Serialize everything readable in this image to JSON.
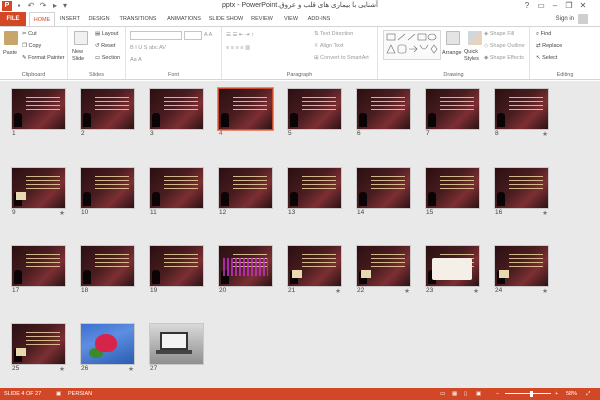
{
  "window": {
    "title": "آشنایی با بیماری های قلب و عروق.pptx - PowerPoint",
    "controls": [
      "?",
      "▭",
      "–",
      "❐",
      "✕"
    ]
  },
  "ribbon_tabs": {
    "file": "FILE",
    "tabs": [
      "HOME",
      "INSERT",
      "DESIGN",
      "TRANSITIONS",
      "ANIMATIONS",
      "SLIDE SHOW",
      "REVIEW",
      "VIEW",
      "ADD-INS"
    ],
    "active": "HOME",
    "sign_in": "Sign in"
  },
  "ribbon": {
    "clipboard": {
      "paste": "Paste",
      "cut": "Cut",
      "copy": "Copy",
      "format_painter": "Format Painter",
      "label": "Clipboard"
    },
    "slides": {
      "new_slide": "New Slide",
      "layout": "Layout",
      "reset": "Reset",
      "section": "Section",
      "label": "Slides"
    },
    "font": {
      "label": "Font"
    },
    "paragraph": {
      "text_direction": "Text Direction",
      "align_text": "Align Text",
      "convert_smartart": "Convert to SmartArt",
      "label": "Paragraph"
    },
    "drawing": {
      "arrange": "Arrange",
      "quick_styles": "Quick Styles",
      "shape_fill": "Shape Fill",
      "shape_outline": "Shape Outline",
      "shape_effects": "Shape Effects",
      "label": "Drawing"
    },
    "editing": {
      "find": "Find",
      "replace": "Replace",
      "select": "Select",
      "label": "Editing"
    }
  },
  "slides": [
    {
      "number": "1",
      "star": ""
    },
    {
      "number": "2",
      "star": ""
    },
    {
      "number": "3",
      "star": ""
    },
    {
      "number": "4",
      "star": ""
    },
    {
      "number": "5",
      "star": ""
    },
    {
      "number": "6",
      "star": ""
    },
    {
      "number": "7",
      "star": ""
    },
    {
      "number": "8",
      "star": "★"
    },
    {
      "number": "9",
      "star": "★"
    },
    {
      "number": "10",
      "star": ""
    },
    {
      "number": "11",
      "star": ""
    },
    {
      "number": "12",
      "star": ""
    },
    {
      "number": "13",
      "star": ""
    },
    {
      "number": "14",
      "star": ""
    },
    {
      "number": "15",
      "star": ""
    },
    {
      "number": "16",
      "star": "★"
    },
    {
      "number": "17",
      "star": ""
    },
    {
      "number": "18",
      "star": ""
    },
    {
      "number": "19",
      "star": ""
    },
    {
      "number": "20",
      "star": ""
    },
    {
      "number": "21",
      "star": "★"
    },
    {
      "number": "22",
      "star": "★"
    },
    {
      "number": "23",
      "star": "★"
    },
    {
      "number": "24",
      "star": "★"
    },
    {
      "number": "25",
      "star": "★"
    },
    {
      "number": "26",
      "star": "★"
    },
    {
      "number": "27",
      "star": ""
    }
  ],
  "selected_slide": "4",
  "status": {
    "slide_of": "SLIDE 4 OF 27",
    "language": "PERSIAN",
    "zoom": "58%"
  },
  "colors": {
    "accent": "#d24726",
    "sorter_bg": "#e9e9e9"
  }
}
